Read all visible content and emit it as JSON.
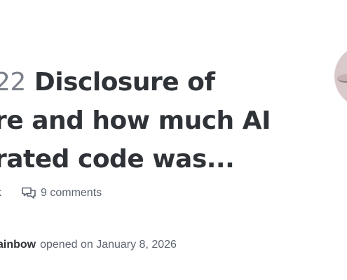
{
  "issue": {
    "number": "22",
    "title_lines": [
      "Disclosure of",
      "re and how much AI",
      "rated code was..."
    ]
  },
  "meta": {
    "truncated_left": "k",
    "comments_label": "9 comments"
  },
  "opened": {
    "author": "ainbow",
    "text": "opened on January 8, 2026"
  },
  "icons": {
    "comments": "comments-icon",
    "avatar": "avatar"
  },
  "colors": {
    "title": "#2f3338",
    "muted": "#5d6470",
    "avatar_bg": "#d9c9ca"
  }
}
